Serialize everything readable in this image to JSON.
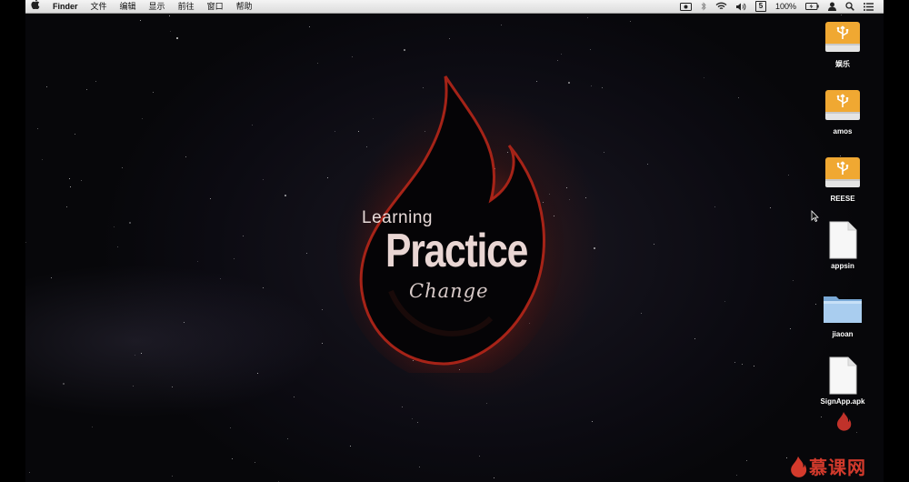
{
  "menubar": {
    "apple_icon": "apple-logo-icon",
    "app_name": "Finder",
    "menus": [
      "文件",
      "编辑",
      "显示",
      "前往",
      "窗口",
      "帮助"
    ],
    "status": {
      "battery_percent": "100%",
      "input_method": "5"
    }
  },
  "logo": {
    "line1": "Learning",
    "line2": "Practice",
    "line3": "Change",
    "accent_color": "#c0281a"
  },
  "desktop_icons": [
    {
      "label": "娱乐",
      "type": "usb-drive-icon"
    },
    {
      "label": "amos",
      "type": "usb-drive-icon"
    },
    {
      "label": "REESE",
      "type": "usb-drive-icon"
    },
    {
      "label": "appsin",
      "type": "document-icon"
    },
    {
      "label": "jiaoan",
      "type": "folder-icon"
    },
    {
      "label": "SignApp.apk",
      "type": "document-icon"
    }
  ],
  "watermark": {
    "text": "慕课网",
    "color": "#d33a2c"
  }
}
